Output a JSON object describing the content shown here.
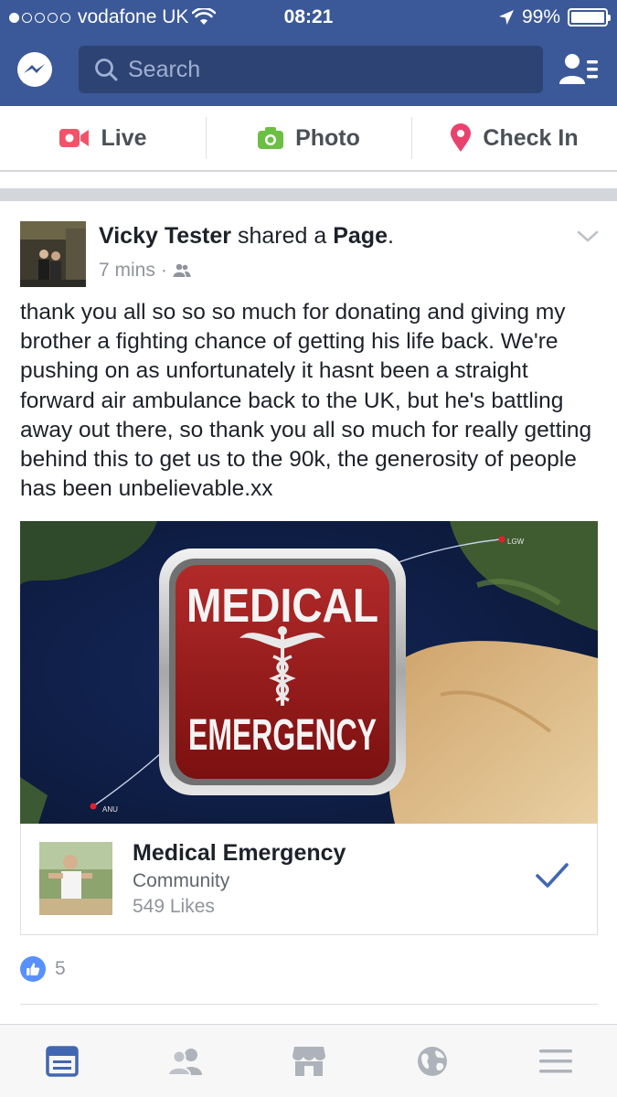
{
  "status_bar": {
    "carrier": "vodafone UK",
    "time": "08:21",
    "battery": "99%",
    "battery_level": 0.99
  },
  "header": {
    "search_placeholder": "Search"
  },
  "composer": {
    "actions": [
      {
        "label": "Live",
        "icon": "video-camera-icon",
        "color": "#f35369"
      },
      {
        "label": "Photo",
        "icon": "camera-icon",
        "color": "#6bbf45"
      },
      {
        "label": "Check In",
        "icon": "location-pin-icon",
        "color": "#e9426d"
      }
    ]
  },
  "post": {
    "author": "Vicky Tester",
    "action_text": "shared a",
    "object": "Page",
    "period": ".",
    "time": "7 mins",
    "separator": "·",
    "privacy_icon": "friends-icon",
    "text": "thank you all so so so much for donating and giving my brother a fighting chance of getting his life back. We're pushing on as unfortunately it hasnt been a straight forward air ambulance back to the UK, but he's battling away out there, so thank you all so much for really getting behind this to get us to the 90k, the generosity of people has been unbelievable.xx",
    "media": {
      "sign_top": "MEDICAL",
      "sign_bottom": "EMERGENCY",
      "map_label_1": "LGW",
      "map_label_2": "ANU"
    },
    "shared_page": {
      "name": "Medical Emergency",
      "category": "Community",
      "likes": "549 Likes"
    },
    "like_count": "5"
  },
  "tabbar": {
    "tabs": [
      {
        "name": "news-feed",
        "icon": "news-feed-icon",
        "active": true
      },
      {
        "name": "friends",
        "icon": "friends-icon",
        "active": false
      },
      {
        "name": "marketplace",
        "icon": "marketplace-icon",
        "active": false
      },
      {
        "name": "notifications",
        "icon": "globe-icon",
        "active": false
      },
      {
        "name": "more",
        "icon": "menu-icon",
        "active": false
      }
    ]
  },
  "colors": {
    "brand": "#3b5998",
    "accent": "#4267b2",
    "like": "#5890ff"
  }
}
